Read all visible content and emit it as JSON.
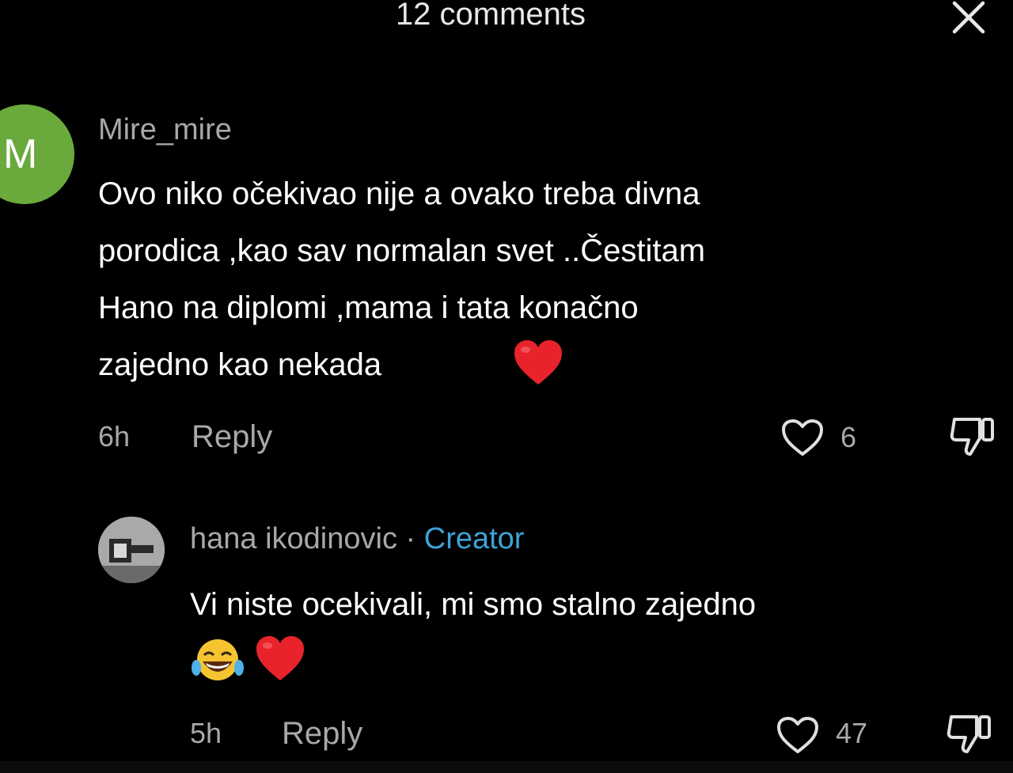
{
  "header": {
    "title": "12 comments"
  },
  "icons": {
    "close": "close-icon",
    "heart": "heart-outline-icon",
    "dislike": "thumbs-down-icon"
  },
  "colors": {
    "background": "#000000",
    "avatar_green": "#6aaa3c",
    "creator_blue": "#3ea2d6",
    "muted_text": "#a8a8a8",
    "heart_red": "#e8232b"
  },
  "comments": [
    {
      "avatar_letter": "M",
      "username": "Mire_mire",
      "lines": [
        "Ovo niko očekivao nije a ovako treba divna",
        "porodica ,kao sav normalan svet ..Čestitam",
        "Hano na diplomi ,mama i tata konačno",
        "zajedno kao nekada"
      ],
      "emoji": "❤️",
      "time": "6h",
      "reply_label": "Reply",
      "likes": "6"
    },
    {
      "username": "hana ikodinovic",
      "separator": " · ",
      "badge": "Creator",
      "lines": [
        "Vi niste ocekivali, mi smo stalno zajedno"
      ],
      "emoji": "😂❤️",
      "time": "5h",
      "reply_label": "Reply",
      "likes": "47"
    }
  ]
}
